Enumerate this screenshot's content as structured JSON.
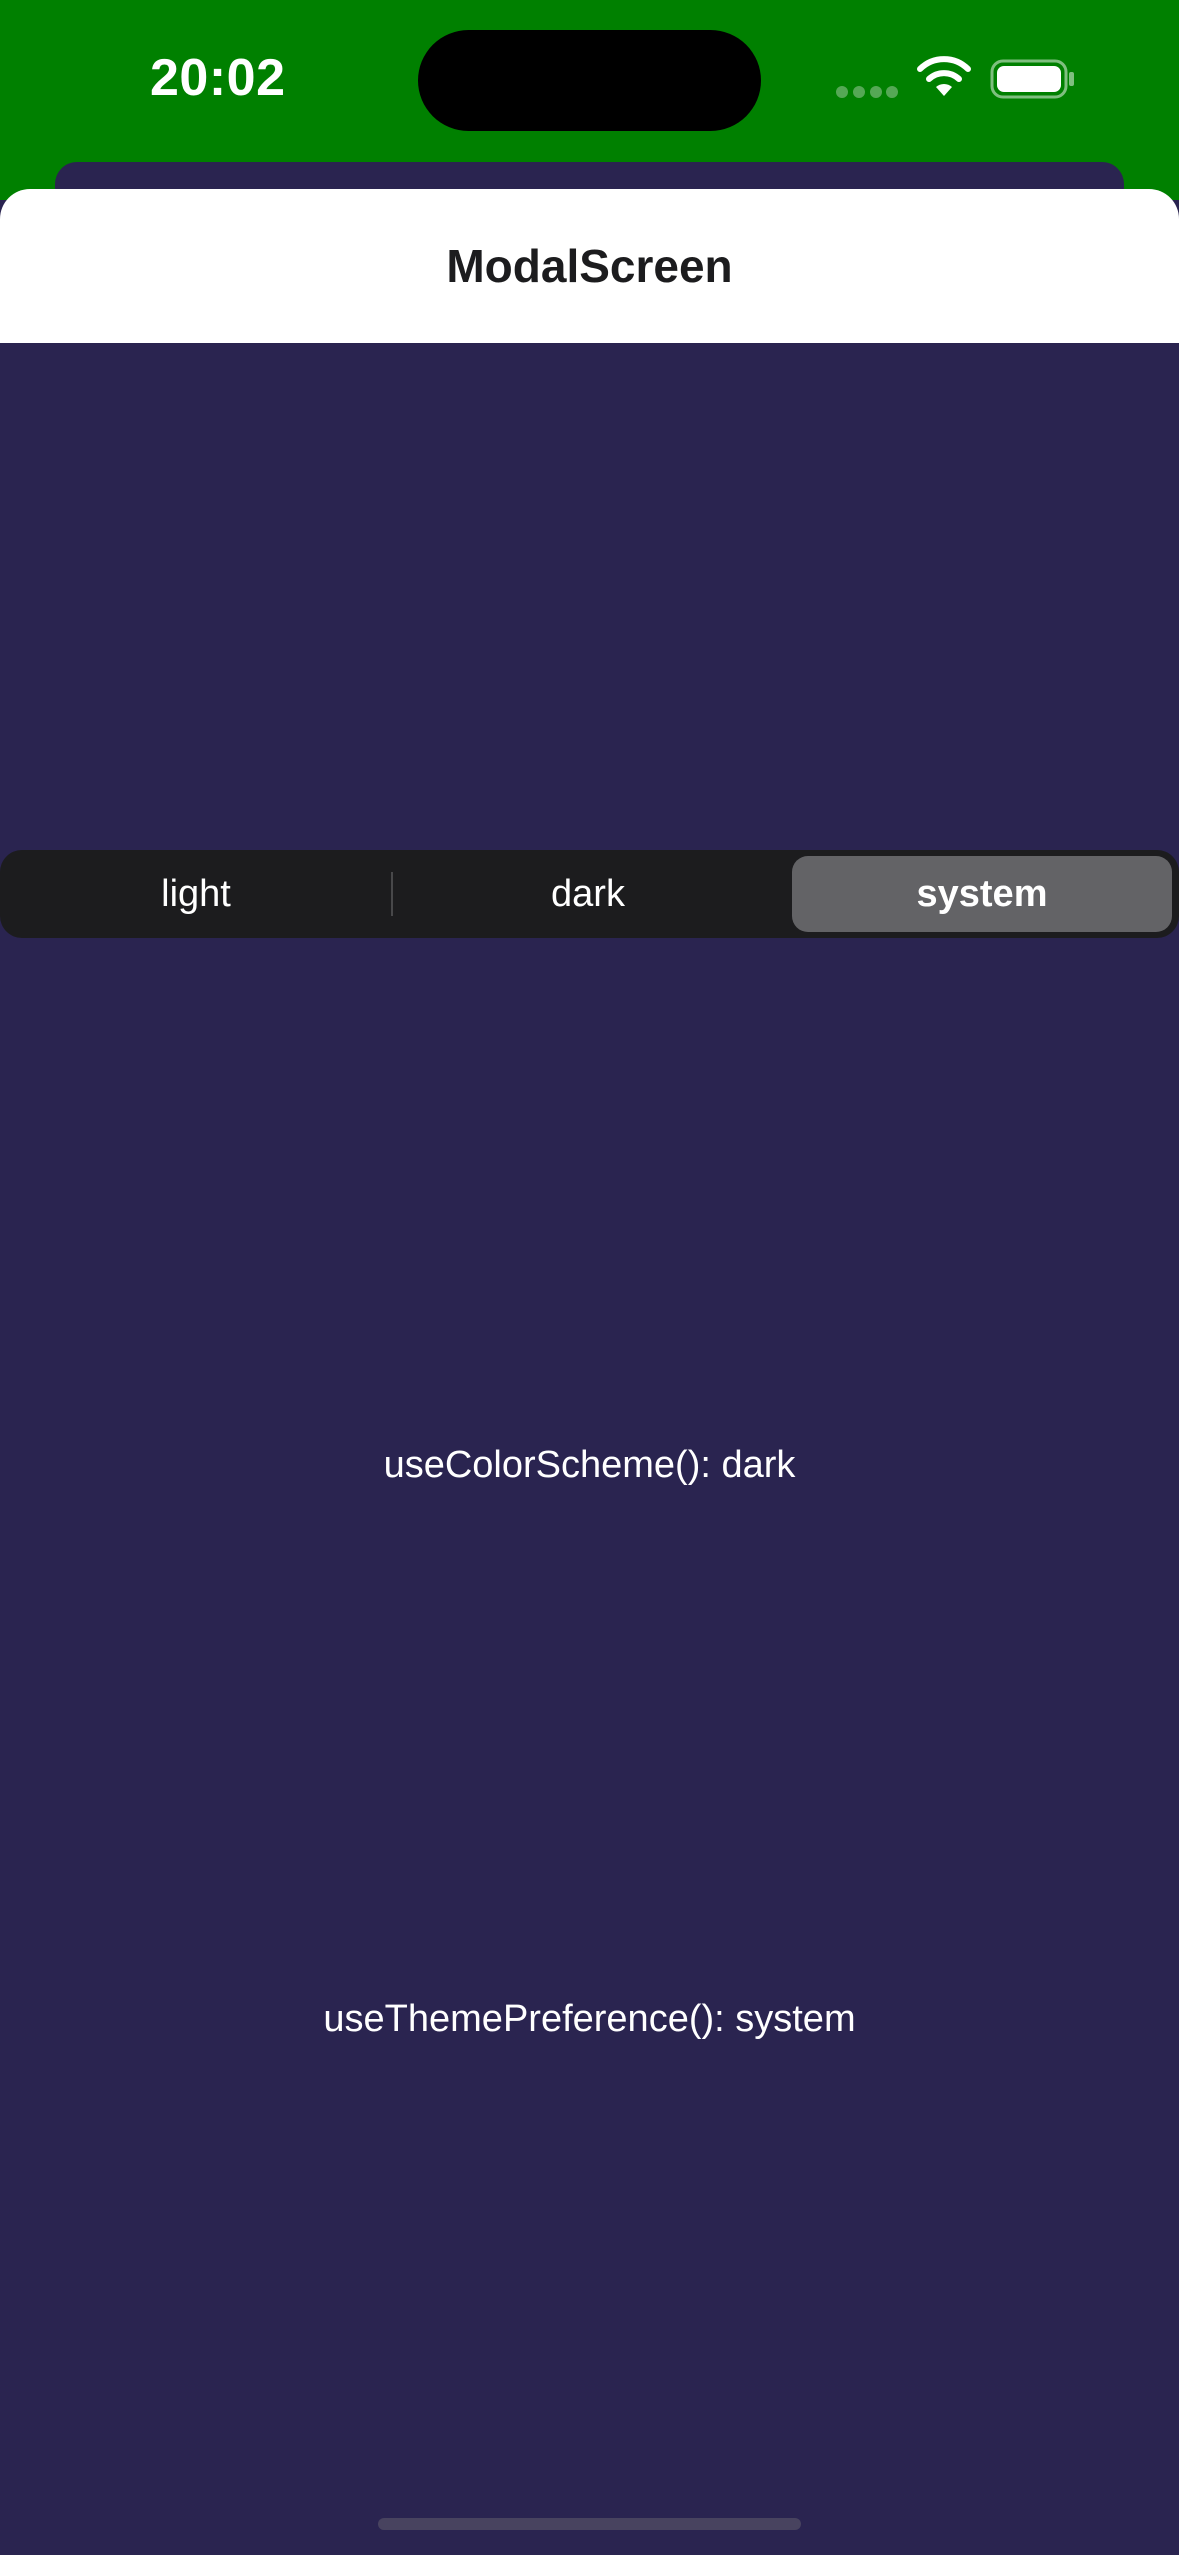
{
  "status_bar": {
    "time": "20:02",
    "background_color": "#008000"
  },
  "modal": {
    "title": "ModalScreen",
    "background_color": "#2a2450"
  },
  "theme_selector": {
    "options": [
      {
        "label": "light",
        "selected": false
      },
      {
        "label": "dark",
        "selected": false
      },
      {
        "label": "system",
        "selected": true
      }
    ]
  },
  "info": {
    "color_scheme": "useColorScheme(): dark",
    "theme_preference": "useThemePreference(): system"
  },
  "icons": {
    "signal": "cellular-signal-icon",
    "wifi": "wifi-icon",
    "battery": "battery-icon"
  }
}
